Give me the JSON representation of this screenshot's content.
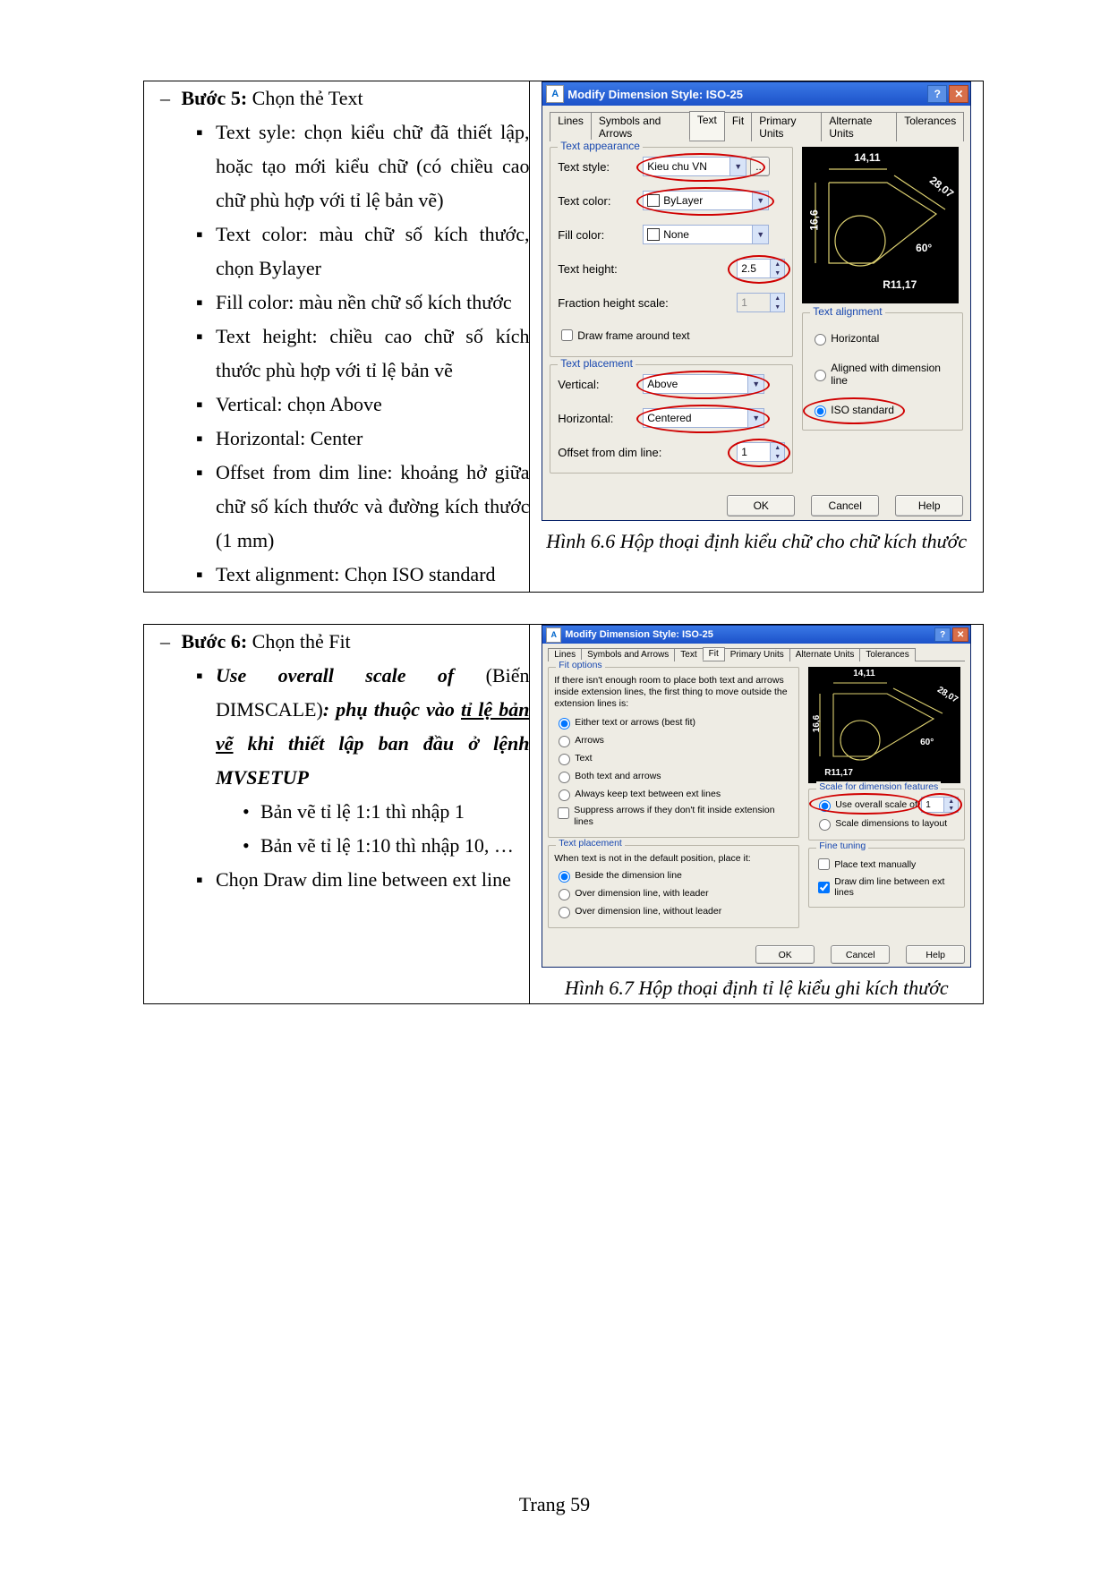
{
  "footer": "Trang 59",
  "row1": {
    "step_label": "Bước 5:",
    "step_text": " Chọn thẻ Text",
    "bullets": [
      "Text syle: chọn kiểu chữ đã thiết lập, hoặc tạo mới kiểu chữ (có chiều cao chữ phù hợp với tỉ lệ bản vẽ)",
      "Text color: màu chữ số kích thước, chọn Bylayer",
      "Fill color: màu nền chữ số kích thước",
      "Text height: chiều cao chữ số kích thước phù hợp với tỉ lệ bản vẽ",
      "Vertical: chọn Above",
      "Horizontal: Center",
      "Offset from dim line: khoảng hở giữa chữ số kích thước và đường kích thước (1 mm)",
      "Text alignment: Chọn ISO standard"
    ],
    "caption": "Hình 6.6 Hộp thoại định kiểu chữ cho chữ kích thước"
  },
  "row2": {
    "step_label": "Bước 6:",
    "step_text": " Chọn thẻ Fit",
    "bullet_main_a": "Use overall scale of",
    "bullet_main_b": " (Biến DIMSCALE)",
    "bullet_main_c": ": phụ thuộc vào ",
    "bullet_main_d": "tỉ lệ bản vẽ",
    "bullet_main_e": " khi thiết lập ban đầu ở lệnh MVSETUP",
    "sub_bullets": [
      "Bản vẽ tỉ lệ 1:1 thì nhập 1",
      "Bản vẽ tỉ lệ 1:10 thì nhập 10, …"
    ],
    "bullet2": "Chọn Draw dim line between ext line",
    "caption": "Hình 6.7 Hộp thoại định tỉ lệ kiểu ghi kích thước"
  },
  "dlg1": {
    "title": "Modify Dimension Style: ISO-25",
    "tabs": [
      "Lines",
      "Symbols and Arrows",
      "Text",
      "Fit",
      "Primary Units",
      "Alternate Units",
      "Tolerances"
    ],
    "active_tab": 2,
    "group_appearance": "Text appearance",
    "lbl_style": "Text style:",
    "val_style": "Kieu chu VN",
    "lbl_color": "Text color:",
    "val_color": "ByLayer",
    "lbl_fill": "Fill color:",
    "val_fill": "None",
    "lbl_height": "Text height:",
    "val_height": "2.5",
    "lbl_frac": "Fraction height scale:",
    "val_frac": "1",
    "chk_frame": "Draw frame around text",
    "group_place": "Text placement",
    "lbl_vert": "Vertical:",
    "val_vert": "Above",
    "lbl_horiz": "Horizontal:",
    "val_horiz": "Centered",
    "lbl_offset": "Offset from dim line:",
    "val_offset": "1",
    "group_align": "Text alignment",
    "rad_horiz": "Horizontal",
    "rad_align": "Aligned with dimension line",
    "rad_iso": "ISO standard",
    "btn_ok": "OK",
    "btn_cancel": "Cancel",
    "btn_help": "Help",
    "preview_labels": {
      "top": "14,11",
      "left": "16,6",
      "diag": "28,07",
      "ang": "60°",
      "rad": "R11,17"
    }
  },
  "dlg2": {
    "title": "Modify Dimension Style: ISO-25",
    "tabs": [
      "Lines",
      "Symbols and Arrows",
      "Text",
      "Fit",
      "Primary Units",
      "Alternate Units",
      "Tolerances"
    ],
    "active_tab": 3,
    "group_fit": "Fit options",
    "fit_intro": "If there isn't enough room to place both text and arrows inside extension lines, the first thing to move outside the extension lines is:",
    "rad_either": "Either text or arrows (best fit)",
    "rad_arrows": "Arrows",
    "rad_text": "Text",
    "rad_both": "Both text and arrows",
    "rad_always": "Always keep text between ext lines",
    "chk_suppress": "Suppress arrows if they don't fit inside extension lines",
    "group_place": "Text placement",
    "place_intro": "When text is not in the default position, place it:",
    "rad_beside": "Beside the dimension line",
    "rad_over_leader": "Over dimension line, with leader",
    "rad_over_noleader": "Over dimension line, without leader",
    "group_scale": "Scale for dimension features",
    "rad_overall": "Use overall scale of:",
    "val_overall": "1",
    "rad_layout": "Scale dimensions to layout",
    "group_fine": "Fine tuning",
    "chk_manual": "Place text manually",
    "chk_drawdim": "Draw dim line between ext lines",
    "btn_ok": "OK",
    "btn_cancel": "Cancel",
    "btn_help": "Help",
    "preview_labels": {
      "top": "14,11",
      "left": "16,6",
      "diag": "28,07",
      "ang": "60°",
      "rad": "R11,17"
    }
  }
}
